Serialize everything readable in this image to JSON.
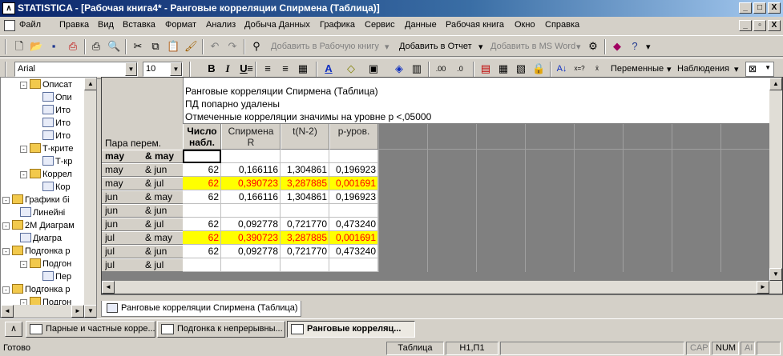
{
  "window": {
    "title": "STATISTICA - [Рабочая книга4* - Ранговые корреляции Спирмена (Таблица)]",
    "app_icon": "statistica-icon",
    "controls": [
      "_",
      "□",
      "X"
    ],
    "child_controls": [
      "_",
      "▫",
      "X"
    ]
  },
  "menu": [
    "Файл",
    "Правка",
    "Вид",
    "Вставка",
    "Формат",
    "Анализ",
    "Добыча Данных",
    "Графика",
    "Сервис",
    "Данные",
    "Рабочая книга",
    "Окно",
    "Справка"
  ],
  "toolbar1": {
    "add_workbook": "Добавить в Рабочую книгу",
    "add_report": "Добавить в Отчет",
    "add_msword": "Добавить в MS Word"
  },
  "toolbar2": {
    "font": "Arial",
    "size": "10",
    "bold": "B",
    "italic": "I",
    "underline": "U",
    "variables": "Переменные",
    "cases": "Наблюдения"
  },
  "tree": [
    {
      "label": "Описат",
      "level": 2,
      "kind": "folder",
      "pm": "-"
    },
    {
      "label": "Опи",
      "level": 3,
      "kind": "doc"
    },
    {
      "label": "Ито",
      "level": 3,
      "kind": "doc"
    },
    {
      "label": "Ито",
      "level": 3,
      "kind": "doc"
    },
    {
      "label": "Ито",
      "level": 3,
      "kind": "doc"
    },
    {
      "label": "Т-крите",
      "level": 2,
      "kind": "folder",
      "pm": "-"
    },
    {
      "label": "Т-кр",
      "level": 3,
      "kind": "doc"
    },
    {
      "label": "Коррел",
      "level": 2,
      "kind": "folder",
      "pm": "-"
    },
    {
      "label": "Кор",
      "level": 3,
      "kind": "doc"
    },
    {
      "label": "Графики бі",
      "level": 1,
      "kind": "folder",
      "pm": "-"
    },
    {
      "label": "Линейні",
      "level": 2,
      "kind": "doc"
    },
    {
      "label": "2М Диаграм",
      "level": 1,
      "kind": "folder",
      "pm": "-"
    },
    {
      "label": "Диагра",
      "level": 2,
      "kind": "doc"
    },
    {
      "label": "Подгонка р",
      "level": 1,
      "kind": "folder",
      "pm": "-"
    },
    {
      "label": "Подгон",
      "level": 2,
      "kind": "folder",
      "pm": "-"
    },
    {
      "label": "Пер",
      "level": 3,
      "kind": "doc"
    },
    {
      "label": "Подгонка р",
      "level": 1,
      "kind": "folder",
      "pm": "-"
    },
    {
      "label": "Подгон",
      "level": 2,
      "kind": "folder",
      "pm": "-"
    }
  ],
  "table": {
    "title_lines": [
      "Ранговые корреляции Спирмена (Таблица)",
      "ПД попарно удалены",
      "Отмеченные корреляции значимы на уровне p <,05000"
    ],
    "corner_label": "Пара перем.",
    "col_headers": [
      {
        "line1": "Число",
        "line2": "набл."
      },
      {
        "line1": "Спирмена",
        "line2": "R"
      },
      {
        "line1": "t(N-2)",
        "line2": ""
      },
      {
        "line1": "p-уров.",
        "line2": ""
      }
    ],
    "rows": [
      {
        "v1": "may",
        "v2": "& may",
        "n": "",
        "r": "",
        "t": "",
        "p": "",
        "highlight": false,
        "bold": true
      },
      {
        "v1": "may",
        "v2": "& jun",
        "n": "62",
        "r": "0,166116",
        "t": "1,304861",
        "p": "0,196923",
        "highlight": false
      },
      {
        "v1": "may",
        "v2": "& jul",
        "n": "62",
        "r": "0,390723",
        "t": "3,287885",
        "p": "0,001691",
        "highlight": true
      },
      {
        "v1": "jun",
        "v2": "& may",
        "n": "62",
        "r": "0,166116",
        "t": "1,304861",
        "p": "0,196923",
        "highlight": false
      },
      {
        "v1": "jun",
        "v2": "& jun",
        "n": "",
        "r": "",
        "t": "",
        "p": "",
        "highlight": false
      },
      {
        "v1": "jun",
        "v2": "& jul",
        "n": "62",
        "r": "0,092778",
        "t": "0,721770",
        "p": "0,473240",
        "highlight": false
      },
      {
        "v1": "jul",
        "v2": "& may",
        "n": "62",
        "r": "0,390723",
        "t": "3,287885",
        "p": "0,001691",
        "highlight": true
      },
      {
        "v1": "jul",
        "v2": "& jun",
        "n": "62",
        "r": "0,092778",
        "t": "0,721770",
        "p": "0,473240",
        "highlight": false
      },
      {
        "v1": "jul",
        "v2": "& jul",
        "n": "",
        "r": "",
        "t": "",
        "p": "",
        "highlight": false
      }
    ]
  },
  "sheet_tab": "Ранговые корреляции Спирмена (Таблица)",
  "tasks": [
    {
      "label": "Парные и частные корре...",
      "active": false
    },
    {
      "label": "Подгонка к непрерывны...",
      "active": false
    },
    {
      "label": "Ранговые корреляц...",
      "active": true
    }
  ],
  "status": {
    "ready": "Готово",
    "sheet": "Таблица",
    "cell": "H1,П1",
    "cap": "CAP",
    "num": "NUM",
    "ai": "AI"
  },
  "colors": {
    "highlight_bg": "#ffff00",
    "highlight_text": "#ff0000",
    "title_bar": "#0a246a"
  }
}
